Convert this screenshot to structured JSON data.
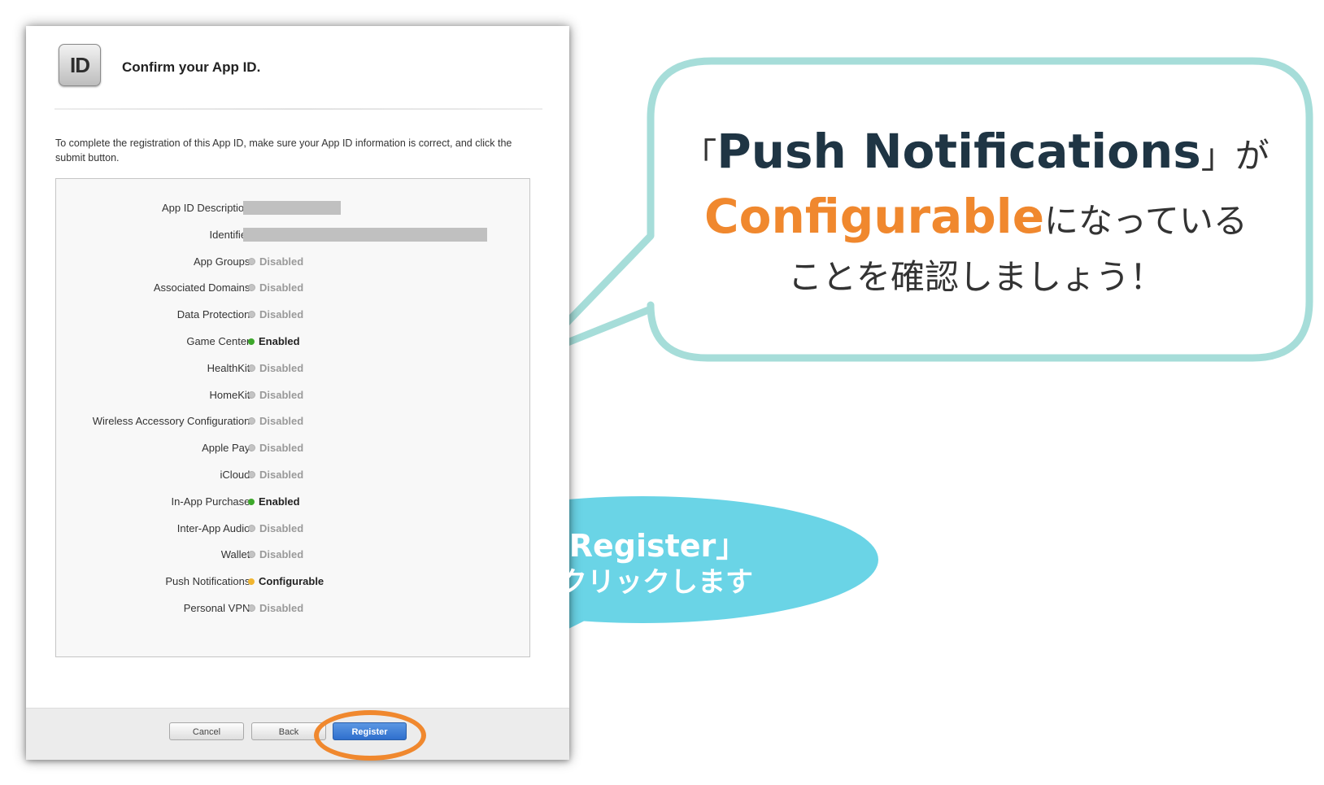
{
  "dialog": {
    "icon_text": "ID",
    "title": "Confirm your App ID.",
    "intro": "To complete the registration of this App ID, make sure your App ID information is correct, and click the submit button.",
    "rows": [
      {
        "label": "App ID Description:",
        "value": "",
        "status": "redacted"
      },
      {
        "label": "Identifier:",
        "value": "",
        "status": "redacted"
      },
      {
        "label": "App Groups:",
        "value": "Disabled",
        "status": "disabled"
      },
      {
        "label": "Associated Domains:",
        "value": "Disabled",
        "status": "disabled"
      },
      {
        "label": "Data Protection:",
        "value": "Disabled",
        "status": "disabled"
      },
      {
        "label": "Game Center:",
        "value": "Enabled",
        "status": "enabled"
      },
      {
        "label": "HealthKit:",
        "value": "Disabled",
        "status": "disabled"
      },
      {
        "label": "HomeKit:",
        "value": "Disabled",
        "status": "disabled"
      },
      {
        "label": "Wireless Accessory Configuration:",
        "value": "Disabled",
        "status": "disabled"
      },
      {
        "label": "Apple Pay:",
        "value": "Disabled",
        "status": "disabled"
      },
      {
        "label": "iCloud:",
        "value": "Disabled",
        "status": "disabled"
      },
      {
        "label": "In-App Purchase:",
        "value": "Enabled",
        "status": "enabled"
      },
      {
        "label": "Inter-App Audio:",
        "value": "Disabled",
        "status": "disabled"
      },
      {
        "label": "Wallet:",
        "value": "Disabled",
        "status": "disabled"
      },
      {
        "label": "Push Notifications:",
        "value": "Configurable",
        "status": "configurable"
      },
      {
        "label": "Personal VPN:",
        "value": "Disabled",
        "status": "disabled"
      }
    ],
    "buttons": {
      "cancel": "Cancel",
      "back": "Back",
      "register": "Register"
    }
  },
  "callout_main": {
    "open_bracket": "「",
    "keyword": "Push Notifications",
    "close_bracket_ga": "」が",
    "highlight": "Configurable",
    "line2_rest": "になっている",
    "line3": "ことを確認しましょう！"
  },
  "callout_register": {
    "line1": "「Register」",
    "line2": "をクリックします"
  },
  "colors": {
    "accent_orange": "#f0882e",
    "bubble_border": "#a6ddd9",
    "bubble_blue": "#6ad4e6",
    "enabled_green": "#3da82b",
    "configurable_yellow": "#f1b52f",
    "register_blue": "#2f6fcd"
  }
}
